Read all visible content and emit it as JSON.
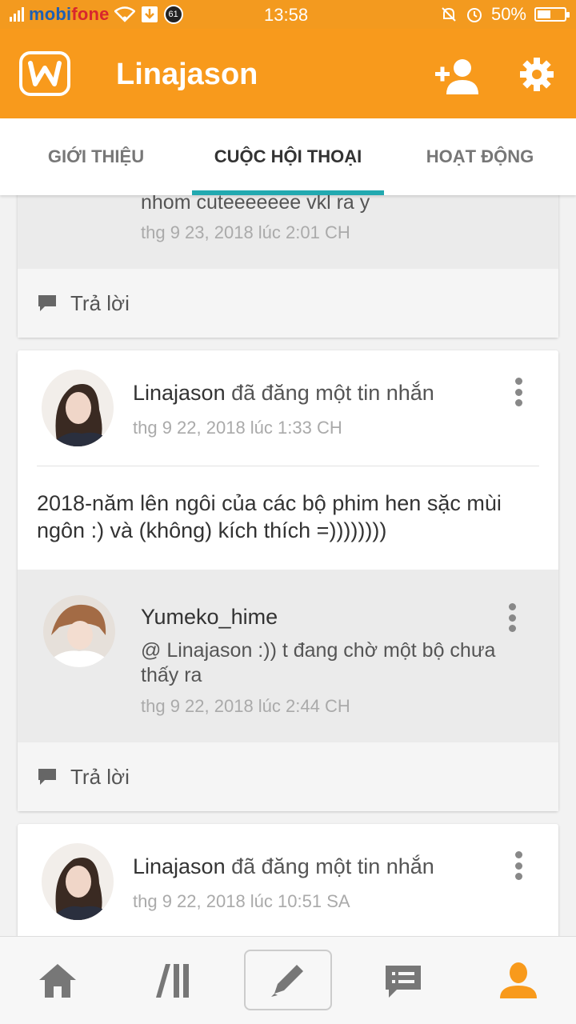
{
  "status_bar": {
    "carrier_part1": "mobi",
    "carrier_part2": "fone",
    "notification_badge": "61",
    "time": "13:58",
    "battery_percent": "50%",
    "battery_level": 0.5
  },
  "app_bar": {
    "title": "Linajason",
    "color": "#f89a1c"
  },
  "tabs": [
    {
      "label": "GIỚI THIỆU"
    },
    {
      "label": "CUỘC HỘI THOẠI"
    },
    {
      "label": "HOẠT ĐỘNG"
    }
  ],
  "accent_color": "#22a9b0",
  "feed": {
    "partial_post": {
      "text_fragment": "nhom cuteeeeeee vkl ra y",
      "timestamp": "thg 9 23, 2018 lúc 2:01 CH",
      "reply_label": "Trả lời"
    },
    "post1": {
      "author": "Linajason",
      "action": "đã đăng một tin nhắn",
      "timestamp": "thg 9 22, 2018 lúc 1:33 CH",
      "message_line1": "2018-năm lên ngôi của các bộ phim hen sặc mùi",
      "message_line2": "ngôn :) và (không) kích thích =))))))))",
      "comment": {
        "author": "Yumeko_hime",
        "text_line1": "@ Linajason  :)) t đang chờ một bộ chưa",
        "text_line2": "thấy ra",
        "timestamp": "thg 9 22, 2018 lúc 2:44 CH"
      },
      "reply_label": "Trả lời"
    },
    "post2": {
      "author": "Linajason",
      "action": "đã đăng một tin nhắn",
      "timestamp": "thg 9 22, 2018 lúc 10:51 SA"
    }
  }
}
